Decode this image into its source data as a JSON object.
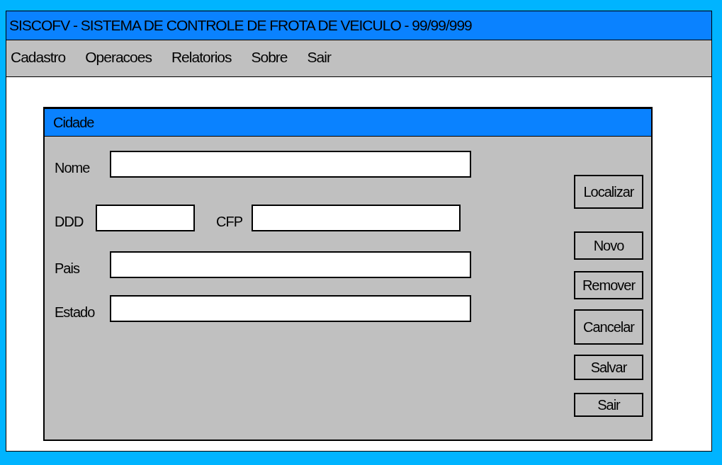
{
  "window": {
    "title": "SISCOFV - SISTEMA DE CONTROLE DE FROTA DE VEICULO - 99/99/999"
  },
  "menu": [
    "Cadastro",
    "Operacoes",
    "Relatorios",
    "Sobre",
    "Sair"
  ],
  "dialog": {
    "title": "Cidade",
    "rows": [
      {
        "fields": [
          {
            "label": "Nome",
            "kind": "wide"
          }
        ]
      },
      {
        "fields": [
          {
            "label": "DDD",
            "kind": "short"
          },
          {
            "label": "CFP",
            "kind": "medium"
          }
        ]
      },
      {
        "fields": [
          {
            "label": "Pais",
            "kind": "wide"
          }
        ]
      },
      {
        "fields": [
          {
            "label": "Estado",
            "kind": "wide"
          }
        ]
      }
    ],
    "buttons": [
      "Localizar",
      "Novo",
      "Remover",
      "Cancelar",
      "Salvar",
      "Sair"
    ]
  }
}
